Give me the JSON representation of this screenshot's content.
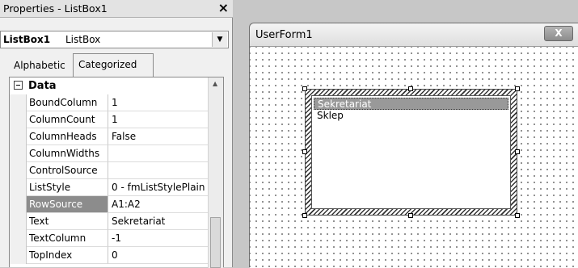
{
  "properties": {
    "title": "Properties - ListBox1",
    "close_glyph": "×",
    "object_selector": {
      "name": "ListBox1",
      "type": "ListBox"
    },
    "tabs": {
      "alphabetic": "Alphabetic",
      "categorized": "Categorized"
    },
    "category": {
      "name": "Data",
      "expanded": true
    },
    "rows": [
      {
        "name": "BoundColumn",
        "value": "1"
      },
      {
        "name": "ColumnCount",
        "value": "1"
      },
      {
        "name": "ColumnHeads",
        "value": "False"
      },
      {
        "name": "ColumnWidths",
        "value": ""
      },
      {
        "name": "ControlSource",
        "value": ""
      },
      {
        "name": "ListStyle",
        "value": "0 - fmListStylePlain"
      },
      {
        "name": "RowSource",
        "value": "A1:A2",
        "selected": true
      },
      {
        "name": "Text",
        "value": "Sekretariat"
      },
      {
        "name": "TextColumn",
        "value": "-1"
      },
      {
        "name": "TopIndex",
        "value": "0"
      }
    ]
  },
  "userform": {
    "caption": "UserForm1",
    "close_label": "X",
    "listbox": {
      "items": [
        "Sekretariat",
        "Sklep"
      ],
      "selected_index": 0
    }
  }
}
